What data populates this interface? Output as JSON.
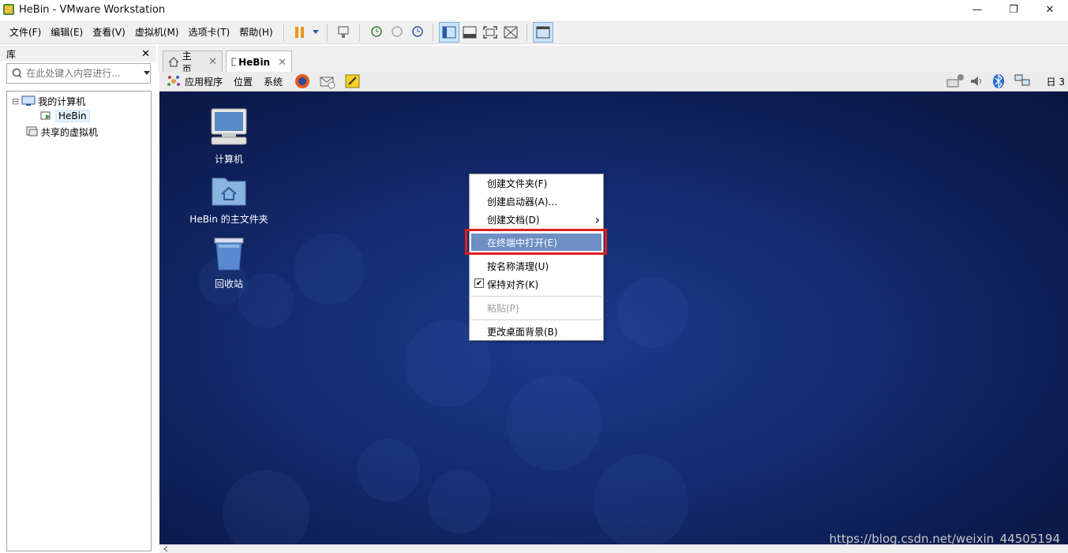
{
  "window": {
    "title": "HeBin - VMware Workstation",
    "controls": {
      "minimize": "—",
      "restore": "❐",
      "close": "✕"
    }
  },
  "menubar": {
    "items": [
      "文件(F)",
      "编辑(E)",
      "查看(V)",
      "虚拟机(M)",
      "选项卡(T)",
      "帮助(H)"
    ]
  },
  "library": {
    "title": "库",
    "close": "✕",
    "search_placeholder": "在此处键入内容进行...",
    "tree": {
      "root_toggle": "⊟",
      "my_computer": "我的计算机",
      "vm": "HeBin",
      "shared": "共享的虚拟机"
    }
  },
  "tabs": [
    {
      "label": "主页",
      "close": "✕"
    },
    {
      "label": "HeBin",
      "close": "✕"
    }
  ],
  "guest_panel": {
    "applications": "应用程序",
    "places": "位置",
    "system": "系统",
    "clock": "日 3"
  },
  "desktop": {
    "icons": [
      {
        "label": "计算机"
      },
      {
        "label": "HeBin 的主文件夹"
      },
      {
        "label": "回收站"
      }
    ],
    "watermark": "https://blog.csdn.net/weixin_44505194"
  },
  "context_menu": {
    "create_folder": "创建文件夹(F)",
    "create_launcher": "创建启动器(A)...",
    "create_document": "创建文档(D)",
    "submenu_arrow": "›",
    "open_terminal": "在终端中打开(E)",
    "clean_up": "按名称清理(U)",
    "keep_aligned": "保持对齐(K)",
    "keep_aligned_checked": "✔",
    "paste": "粘贴(P)",
    "change_background": "更改桌面背景(B)"
  }
}
